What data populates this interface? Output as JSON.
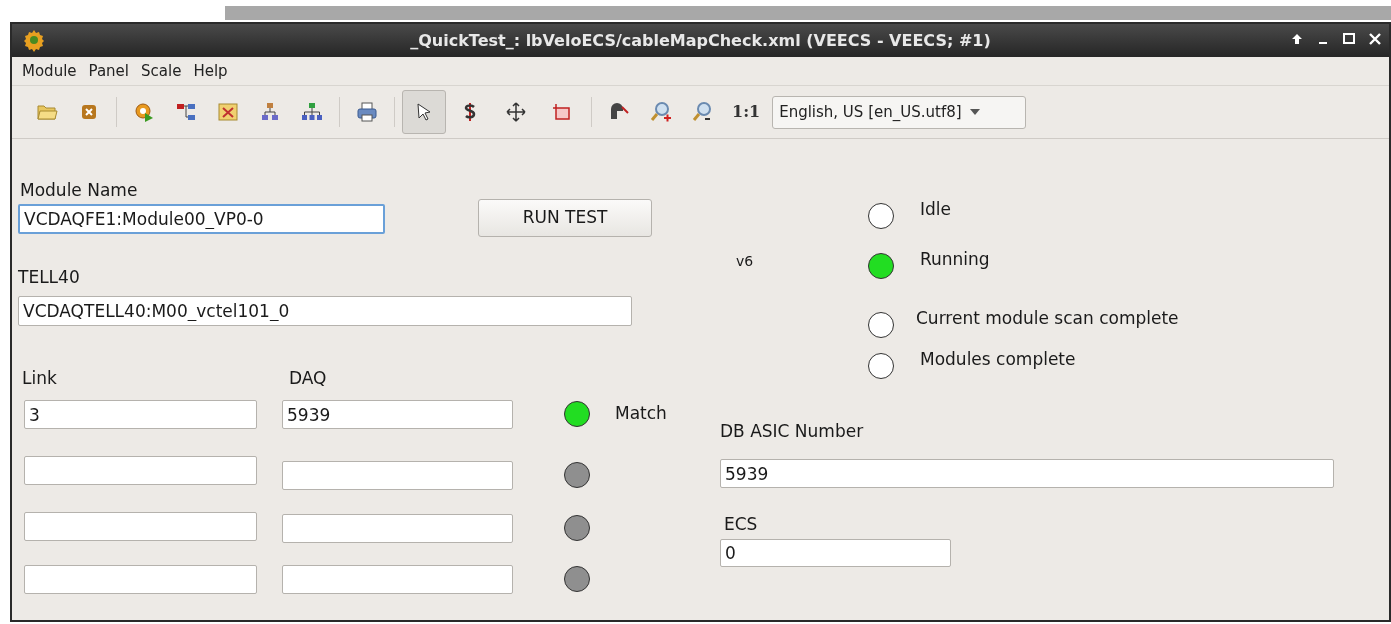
{
  "window": {
    "title": "_QuickTest_: lbVeloECS/cableMapCheck.xml (VEECS - VEECS; #1)"
  },
  "menu": [
    "Module",
    "Panel",
    "Scale",
    "Help"
  ],
  "toolbar": {
    "tools": [
      {
        "selected": true
      },
      {
        "selected": false
      },
      {
        "selected": false
      },
      {
        "selected": false
      }
    ],
    "zoom_label": "1:1",
    "locale": "English, US [en_US.utf8]"
  },
  "module_name": {
    "label": "Module Name",
    "value": "VCDAQFE1:Module00_VP0-0",
    "focused": true
  },
  "run_button": "RUN TEST",
  "tell40": {
    "label": "TELL40",
    "value": "VCDAQTELL40:M00_vctel101_0"
  },
  "version": "v6",
  "states": [
    {
      "label": "Idle",
      "on": false
    },
    {
      "label": "Running",
      "on": true
    },
    {
      "label": "Current module scan complete",
      "on": false
    },
    {
      "label": "Modules complete",
      "on": false
    }
  ],
  "link_header": "Link",
  "daq_header": "DAQ",
  "rows": [
    {
      "link": "3",
      "daq": "5939",
      "on": true,
      "label": "Match"
    },
    {
      "on": false
    },
    {
      "on": false
    },
    {
      "on": false
    }
  ],
  "db_asic": {
    "label": "DB ASIC Number",
    "value": "5939"
  },
  "ecs": {
    "label": "ECS",
    "value": "0"
  }
}
